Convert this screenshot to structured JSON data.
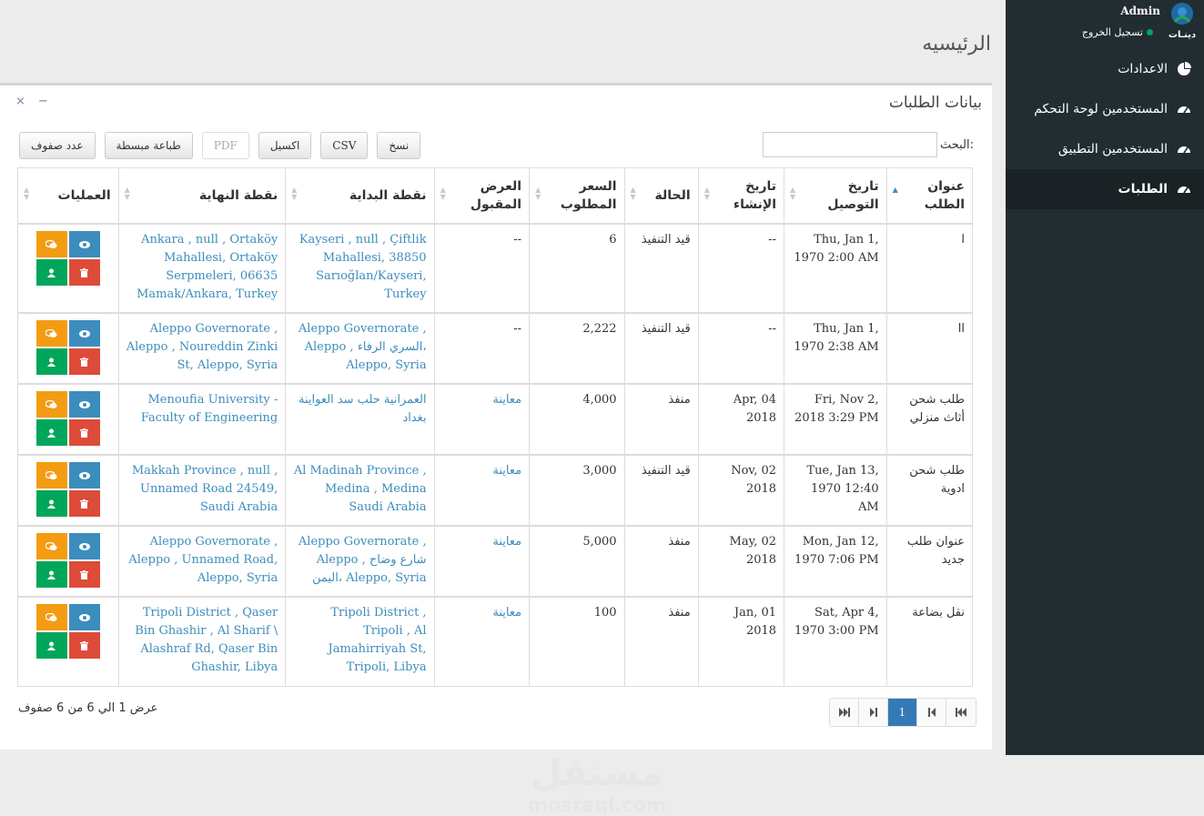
{
  "sidebar": {
    "admin": "Admin",
    "logo_text": "دينـات",
    "logout": "تسجيل الخروج",
    "items": [
      {
        "label": "الاعدادات",
        "icon": "pie-chart-icon"
      },
      {
        "label": "المستخدمين لوحة التحكم",
        "icon": "dashboard-icon"
      },
      {
        "label": "المستخدمين التطبيق",
        "icon": "dashboard-icon"
      },
      {
        "label": "الطلبات",
        "icon": "dashboard-icon",
        "active": true
      }
    ]
  },
  "page_title": "الرئيسيه",
  "box": {
    "title": "بيانات الطلبات",
    "minimize": "−",
    "close": "×"
  },
  "buttons": {
    "copy": "نسخ",
    "csv": "CSV",
    "excel": "اكسيل",
    "pdf": "PDF",
    "print": "طباعة مبسطة",
    "rows": "عدد صفوف"
  },
  "search": {
    "label": "البحث:",
    "value": ""
  },
  "table": {
    "headers": [
      "عنوان الطلب",
      "تاريخ التوصيل",
      "تاريخ الإنشاء",
      "الحالة",
      "السعر المطلوب",
      "العرض المقبول",
      "نقطة البداية",
      "نقطة النهاية",
      "العمليات"
    ],
    "rows": [
      {
        "title": "ا",
        "delivery": "Thu, Jan 1, 1970 2:00 AM",
        "created": "--",
        "status": "قيد التنفيذ",
        "price": "6",
        "offer": "--",
        "start": "Kayseri , null , Çiftlik Mahallesi, 38850 Sarıoğlan/Kayseri, Turkey",
        "end": "Ankara , null , Ortaköy Mahallesi, Ortaköy Serpmeleri, 06635 Mamak/Ankara, Turkey"
      },
      {
        "title": "اا",
        "delivery": "Thu, Jan 1, 1970 2:38 AM",
        "created": "--",
        "status": "قيد التنفيذ",
        "price": "2,222",
        "offer": "--",
        "start": "Aleppo Governorate , Aleppo , السري الرفاء، Aleppo, Syria",
        "end": "Aleppo Governorate , Aleppo , Noureddin Zinki St, Aleppo, Syria"
      },
      {
        "title": "طلب شحن أثاث منزلي",
        "delivery": "Fri, Nov 2, 2018 3:29 PM",
        "created": "Apr, 04 2018",
        "status": "منفذ",
        "price": "4,000",
        "offer": "معاينة",
        "start": "العمرانية حلب سد العواينة بغداد",
        "end": "Menoufia University - Faculty of Engineering"
      },
      {
        "title": "طلب شحن ادوية",
        "delivery": "Tue, Jan 13, 1970 12:40 AM",
        "created": "Nov, 02 2018",
        "status": "قيد التنفيذ",
        "price": "3,000",
        "offer": "معاينة",
        "start": "Al Madinah Province , Medina , Medina Saudi Arabia",
        "end": "Makkah Province , null , Unnamed Road 24549, Saudi Arabia"
      },
      {
        "title": "عنوان طلب جديد",
        "delivery": "Mon, Jan 12, 1970 7:06 PM",
        "created": "May, 02 2018",
        "status": "منفذ",
        "price": "5,000",
        "offer": "معاينة",
        "start": "Aleppo Governorate , Aleppo , شارع وضاح اليمن، Aleppo, Syria",
        "end": "Aleppo Governorate , Aleppo , Unnamed Road, Aleppo, Syria"
      },
      {
        "title": "نقل بضاعة",
        "delivery": "Sat, Apr 4, 1970 3:00 PM",
        "created": "Jan, 01 2018",
        "status": "منفذ",
        "price": "100",
        "offer": "معاينة",
        "start": "Tripoli District , Tripoli , Al Jamahirriyah St, Tripoli, Libya",
        "end": "Tripoli District , Qaser Bin Ghashir , Al Sharif \\ Alashraf Rd, Qaser Bin Ghashir, Libya"
      }
    ]
  },
  "info": "عرض 1 الي 6 من 6 صفوف",
  "pagination": {
    "current": "1"
  },
  "watermark": {
    "arabic": "مستقل",
    "latin": "mostaql.com"
  },
  "colors": {
    "primary": "#3c8dbc",
    "success": "#00a65a",
    "danger": "#dd4b39",
    "warning": "#f39c12",
    "sidebar": "#222d32"
  }
}
